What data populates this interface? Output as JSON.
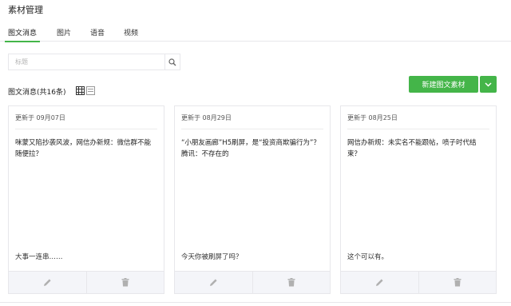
{
  "page": {
    "title": "素材管理"
  },
  "tabs": [
    {
      "label": "图文消息",
      "active": true
    },
    {
      "label": "图片",
      "active": false
    },
    {
      "label": "语音",
      "active": false
    },
    {
      "label": "视频",
      "active": false
    }
  ],
  "search": {
    "placeholder": "标题",
    "value": ""
  },
  "list": {
    "label": "图文消息(共16条)"
  },
  "actions": {
    "new_label": "新建图文素材"
  },
  "colors": {
    "accent": "#44b549",
    "border": "#e7e7eb",
    "action_bar": "#f4f5f9"
  },
  "icons": {
    "search": "search-icon",
    "edit": "pencil-icon",
    "delete": "trash-icon",
    "dropdown": "chevron-down-icon",
    "grid_view": "grid-view-icon",
    "list_view": "list-view-icon"
  },
  "cards": [
    {
      "date": "更新于 09月07日",
      "title": "咪蒙又陷抄袭风波，网信办新规：微信群不能随便拉？",
      "digest": "大事一连串……"
    },
    {
      "date": "更新于 08月29日",
      "title": "“小朋友画廊”H5刷屏，是“投资商欺骗行为”？腾讯：不存在的",
      "digest": "今天你被刷屏了吗？"
    },
    {
      "date": "更新于 08月25日",
      "title": "网信办新规：未实名不能跟帖，喷子时代结束？",
      "digest": "这个可以有。"
    }
  ]
}
